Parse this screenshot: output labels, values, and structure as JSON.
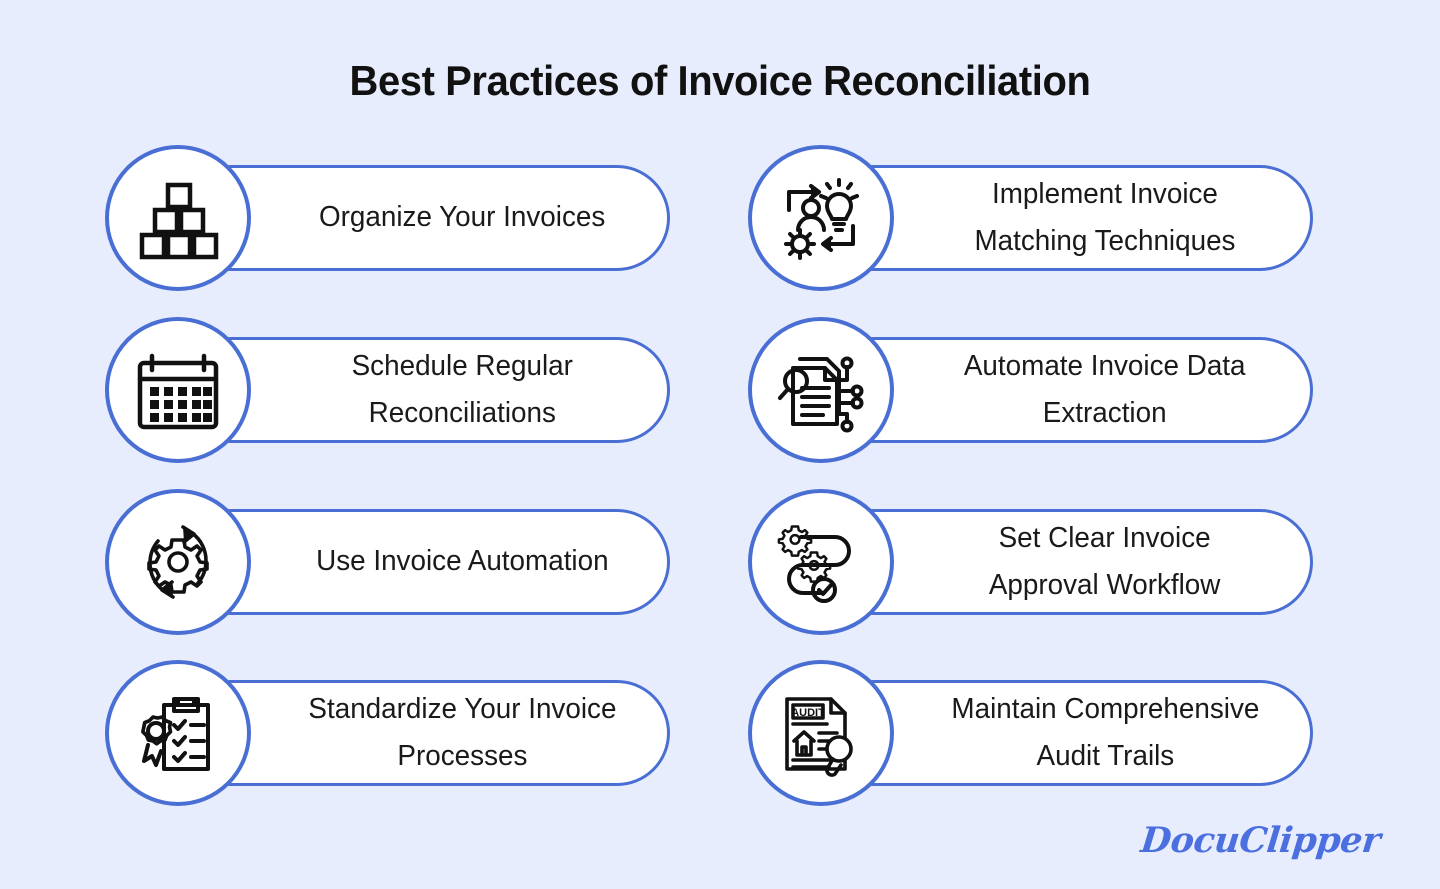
{
  "page": {
    "title": "Best Practices of Invoice Reconciliation",
    "background_color": "#e8edfd",
    "accent_color": "#4a6fd4",
    "text_color": "#1a1a1a",
    "logo_color": "#4c6fe0"
  },
  "brand": {
    "logo_text": "DocuClipper"
  },
  "items": [
    {
      "index": 1,
      "column": "left",
      "row": 0,
      "label": "Organize Your Invoices",
      "lines": 1,
      "icon": "stacked-boxes-icon"
    },
    {
      "index": 2,
      "column": "right",
      "row": 0,
      "label": "Implement Invoice\nMatching Techniques",
      "lines": 2,
      "icon": "person-lightbulb-gear-icon"
    },
    {
      "index": 3,
      "column": "left",
      "row": 1,
      "label": "Schedule Regular\nReconciliations",
      "lines": 2,
      "icon": "calendar-icon"
    },
    {
      "index": 4,
      "column": "right",
      "row": 1,
      "label": "Automate Invoice Data\nExtraction",
      "lines": 2,
      "icon": "document-magnifier-circuit-icon"
    },
    {
      "index": 5,
      "column": "left",
      "row": 2,
      "label": "Use Invoice Automation",
      "lines": 1,
      "icon": "gear-refresh-icon"
    },
    {
      "index": 6,
      "column": "right",
      "row": 2,
      "label": "Set Clear Invoice\nApproval Workflow",
      "lines": 2,
      "icon": "workflow-gears-check-icon"
    },
    {
      "index": 7,
      "column": "left",
      "row": 3,
      "label": "Standardize Your Invoice\nProcesses",
      "lines": 2,
      "icon": "clipboard-checklist-award-icon"
    },
    {
      "index": 8,
      "column": "right",
      "row": 3,
      "label": "Maintain Comprehensive\nAudit Trails",
      "lines": 2,
      "icon": "audit-document-magnifier-icon"
    }
  ]
}
